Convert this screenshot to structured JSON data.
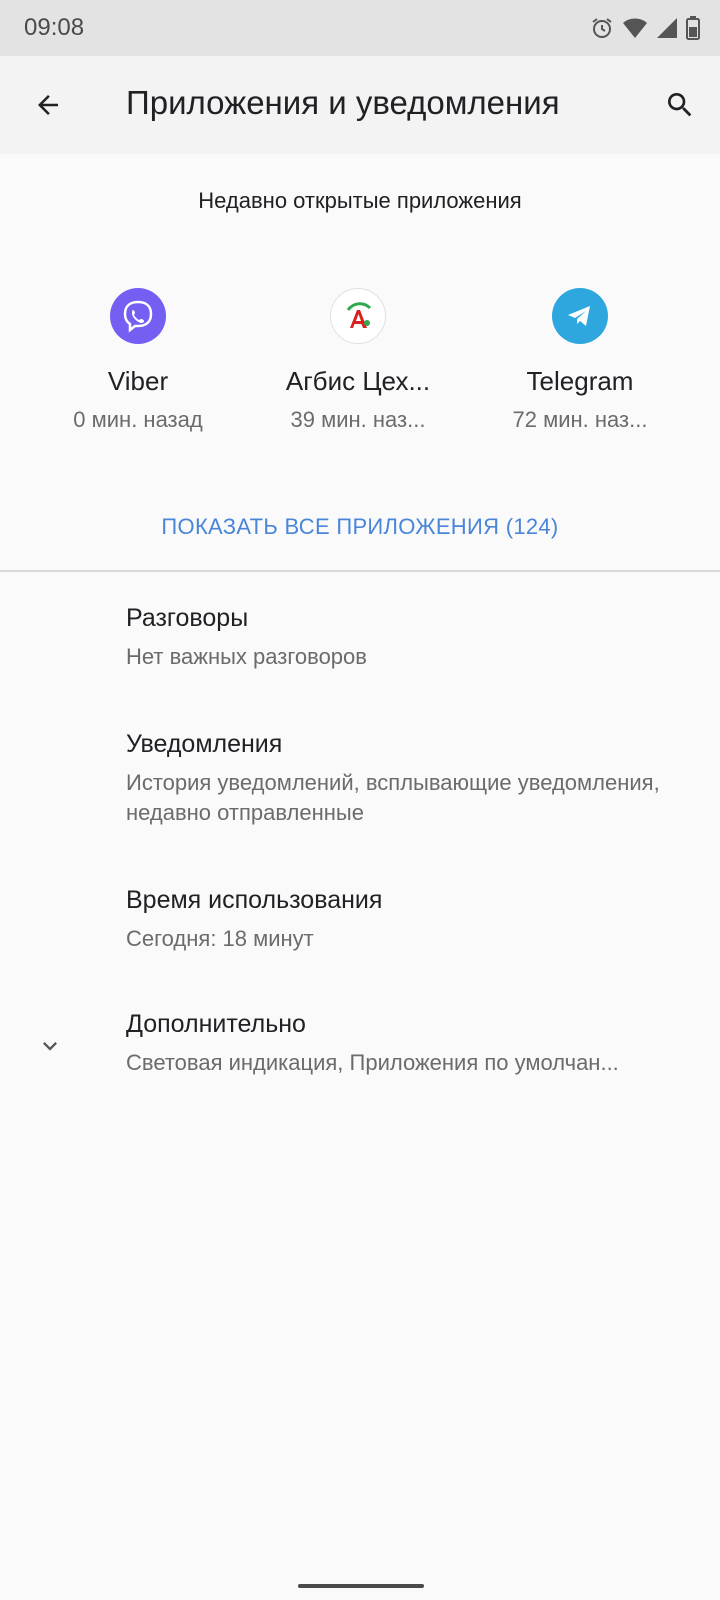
{
  "status_bar": {
    "time": "09:08"
  },
  "app_bar": {
    "title": "Приложения и уведомления"
  },
  "recent": {
    "header": "Недавно открытые приложения",
    "apps": [
      {
        "name": "Viber",
        "time": "0 мин. назад",
        "color": "#7360f2"
      },
      {
        "name": "Агбис Цех...",
        "time": "39 мин. наз...",
        "color": "#ffffff"
      },
      {
        "name": "Telegram",
        "time": "72 мин. наз...",
        "color": "#2ea6de"
      }
    ],
    "show_all": "ПОКАЗАТЬ ВСЕ ПРИЛОЖЕНИЯ (124)"
  },
  "prefs": [
    {
      "title": "Разговоры",
      "subtitle": "Нет важных разговоров"
    },
    {
      "title": "Уведомления",
      "subtitle": "История уведомлений, всплывающие уведомления, недавно отправленные"
    },
    {
      "title": "Время использования",
      "subtitle": "Сегодня: 18 минут"
    },
    {
      "title": "Дополнительно",
      "subtitle": "Световая индикация, Приложения по умолчан..."
    }
  ],
  "colors": {
    "accent": "#4a86d8",
    "secondary_text": "#6b6b6b"
  }
}
